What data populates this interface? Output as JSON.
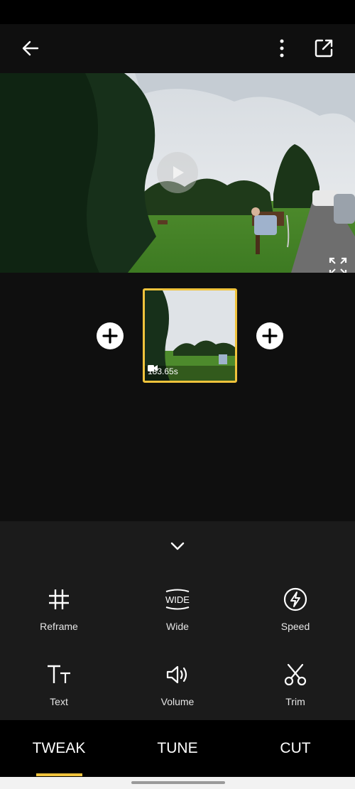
{
  "clip": {
    "duration": "183.65s"
  },
  "tools": [
    {
      "label": "Reframe",
      "icon": "hash-icon"
    },
    {
      "label": "Wide",
      "icon": "wide-icon",
      "icon_text": "WIDE"
    },
    {
      "label": "Speed",
      "icon": "lightning-icon"
    },
    {
      "label": "Text",
      "icon": "text-icon"
    },
    {
      "label": "Volume",
      "icon": "volume-icon"
    },
    {
      "label": "Trim",
      "icon": "scissors-icon"
    }
  ],
  "tabs": [
    {
      "label": "TWEAK",
      "active": true
    },
    {
      "label": "TUNE",
      "active": false
    },
    {
      "label": "CUT",
      "active": false
    }
  ],
  "colors": {
    "accent": "#f0c33c",
    "background": "#0f0f0f",
    "panel": "#1b1b1b"
  }
}
